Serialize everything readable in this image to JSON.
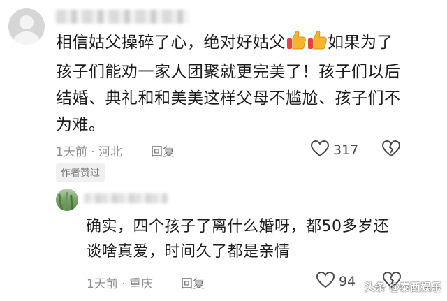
{
  "comments": [
    {
      "text_lines": [
        "相信姑父操碎了心，绝对好姑父",
        "如果为了",
        "孩子们能劝一家人团聚就更完美了！孩子们以后",
        "结婚、典礼和和美美这样父母不尴尬、孩子们不",
        "为难。"
      ],
      "emojis": [
        "thumbs-up-icon",
        "thumbs-up-icon"
      ],
      "time": "1天前",
      "separator": "·",
      "location": "河北",
      "reply_label": "回复",
      "like_count": "317",
      "badge": "作者赞过"
    },
    {
      "text_lines": [
        "确实，四个孩子了离什么婚呀，都50多岁还",
        "谈啥真爱，时间久了都是亲情"
      ],
      "time": "1天前",
      "separator": "·",
      "location": "重庆",
      "reply_label": "回复",
      "like_count": "94"
    }
  ],
  "watermark": "头条 @泰西娱乐",
  "colors": {
    "text": "#1c1c1c",
    "meta": "#8f8f8f",
    "thumb_yellow": "#f7b52c",
    "thumb_red": "#e8413a"
  }
}
